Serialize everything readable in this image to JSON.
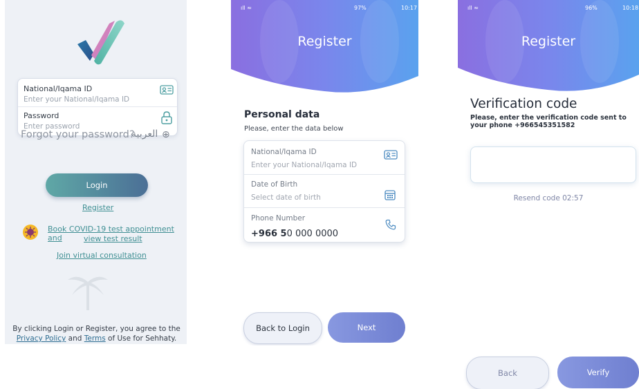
{
  "login_screen": {
    "national_id_label": "National/Iqama ID",
    "national_id_placeholder": "Enter your National/Iqama ID",
    "password_label": "Password",
    "password_placeholder": "Enter password",
    "forgot_password": "Forgot your password?",
    "language": "العربية",
    "login_button": "Login",
    "register_link": "Register",
    "covid_link_line1": "Book COVID-19 test appointment and",
    "covid_link_line2": "view test result",
    "virtual_consult_link": "Join virtual consultation",
    "footer_prefix": "By clicking Login or Register, you agree to the",
    "footer_privacy": "Privacy Policy",
    "footer_and": "and",
    "footer_terms": "Terms",
    "footer_suffix": "of Use for Sehhaty."
  },
  "register_screen": {
    "status_battery": "97%",
    "status_time": "10:17",
    "title": "Register",
    "section_title": "Personal data",
    "section_subtitle": "Please, enter the data below",
    "national_id_label": "National/Iqama ID",
    "national_id_placeholder": "Enter your National/Iqama ID",
    "dob_label": "Date of Birth",
    "dob_placeholder": "Select date of birth",
    "phone_label": "Phone Number",
    "phone_prefix": "+966 5",
    "phone_rest": "0 000 0000",
    "back_button": "Back to Login",
    "next_button": "Next"
  },
  "verify_screen": {
    "status_battery": "96%",
    "status_time": "10:18",
    "title": "Register",
    "heading": "Verification code",
    "subtitle": "Please, enter the verification code sent to your phone +966545351582",
    "resend": "Resend code 02:57",
    "back_button": "Back",
    "verify_button": "Verify"
  },
  "colors": {
    "teal": "#5fa8a6",
    "navy": "#4b6f96",
    "register_gradient_start": "#8a6fe0",
    "register_gradient_end": "#5aa2ee",
    "verify_button": "#7383d4"
  }
}
